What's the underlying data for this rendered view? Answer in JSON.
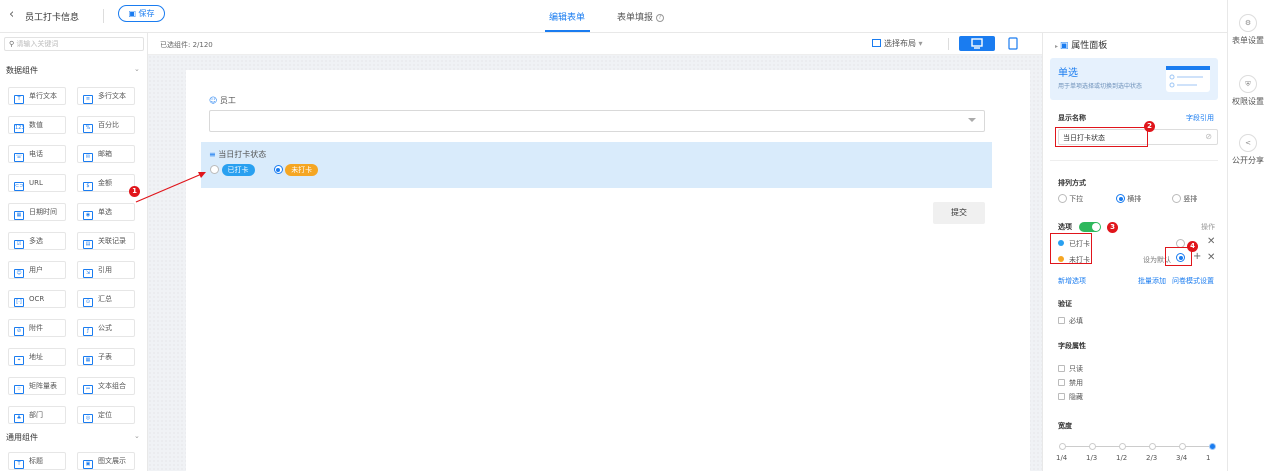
{
  "header": {
    "back_icon": "chevron-left-icon",
    "title": "员工打卡信息",
    "save_label": "保存",
    "tabs": [
      {
        "label": "编辑表单"
      },
      {
        "label": "表单填报"
      }
    ],
    "help_icon": "?"
  },
  "left_panel": {
    "search_placeholder": "请输入关键词",
    "group1_title": "数据组件",
    "group2_title": "通用组件",
    "components": [
      "单行文本",
      "多行文本",
      "数值",
      "百分比",
      "电话",
      "邮箱",
      "URL",
      "金额",
      "日期时间",
      "单选",
      "多选",
      "关联记录",
      "用户",
      "引用",
      "OCR",
      "汇总",
      "附件",
      "公式",
      "地址",
      "子表",
      "矩阵量表",
      "文本组合",
      "部门",
      "定位",
      "标题",
      "图文展示"
    ]
  },
  "workbar": {
    "count_label": "已选组件: 2/120",
    "layout_label": "选择布局"
  },
  "form": {
    "employee_label": "员工",
    "status_label": "当日打卡状态",
    "option_checked": "已打卡",
    "option_unchecked": "未打卡",
    "submit_label": "提交"
  },
  "markers": [
    "1",
    "2",
    "3",
    "4"
  ],
  "props": {
    "panel_title": "属性面板",
    "banner_title": "单选",
    "banner_desc": "用于单项选择或切换到选中状态",
    "display_name_label": "显示名称",
    "field_ref_link": "字段引用",
    "display_name_value": "当日打卡状态",
    "arrange_label": "排列方式",
    "arrange_options": [
      "下拉",
      "横排",
      "竖排"
    ],
    "options_label": "选项",
    "ops_label": "操作",
    "options": [
      {
        "label": "已打卡",
        "color": "#29a0f0"
      },
      {
        "label": "未打卡",
        "color": "#f5a623"
      }
    ],
    "set_default": "设为默认",
    "add_option": "新增选项",
    "batch_add": "批量添加",
    "survey_setting": "问卷模式设置",
    "validate_label": "验证",
    "required": "必填",
    "field_attr_label": "字段属性",
    "attrs": [
      "只读",
      "禁用",
      "隐藏"
    ],
    "width_label": "宽度",
    "width_ticks": [
      "1/4",
      "1/3",
      "1/2",
      "2/3",
      "3/4",
      "1"
    ]
  },
  "side": [
    {
      "label": "表单设置",
      "icon": "settings-icon"
    },
    {
      "label": "权限设置",
      "icon": "shield-icon"
    },
    {
      "label": "公开分享",
      "icon": "share-icon"
    }
  ],
  "colors": {
    "accent": "#1a7cf0",
    "tag_blue": "#29a0f0",
    "tag_orange": "#f5a623",
    "marker_red": "#e0151b"
  }
}
